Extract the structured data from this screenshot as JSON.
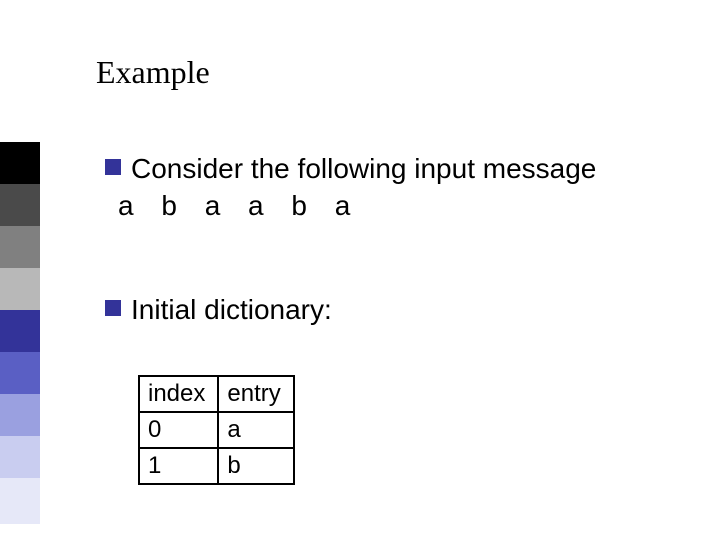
{
  "title": "Example",
  "bullets": {
    "consider": "Consider the following input message",
    "message": "a b a a b a",
    "initial": "Initial dictionary:"
  },
  "table": {
    "header_index": "index",
    "header_entry": "entry",
    "rows": [
      {
        "index": "0",
        "entry": "a"
      },
      {
        "index": "1",
        "entry": "b"
      }
    ]
  },
  "accent_colors": [
    "#000000",
    "#4a4a4a",
    "#808080",
    "#b8b8b8",
    "#333399",
    "#5a5fc4",
    "#9aa0e0",
    "#c9cdf0",
    "#e6e8f8"
  ]
}
